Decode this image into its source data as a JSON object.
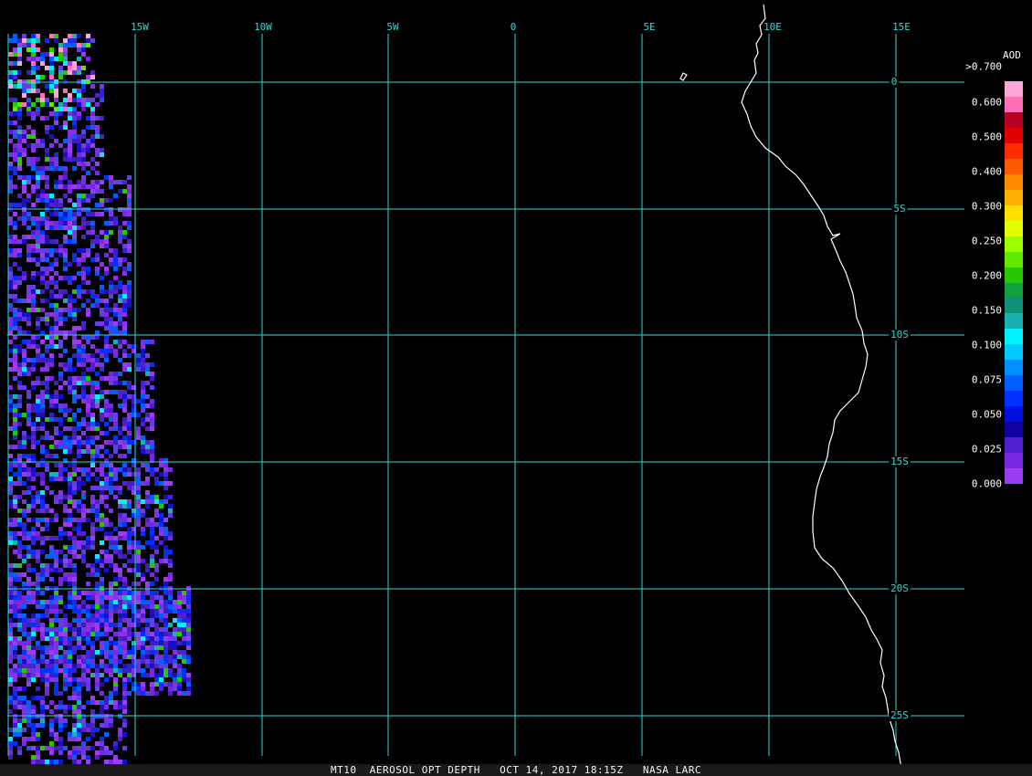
{
  "map": {
    "longitude_labels": [
      "15W",
      "10W",
      "5W",
      "0",
      "5E",
      "10E",
      "15E"
    ],
    "latitude_labels": [
      "0",
      "5S",
      "10S",
      "15S",
      "20S",
      "25S"
    ],
    "grid_color": "#2fd8d8",
    "coastline_color": "#ffffff",
    "background_color": "#000000"
  },
  "legend": {
    "title": "AOD",
    "ticks": [
      ">0.700",
      "0.600",
      "0.500",
      "0.400",
      "0.300",
      "0.250",
      "0.200",
      "0.150",
      "0.100",
      "0.075",
      "0.050",
      "0.025",
      "0.000"
    ],
    "colors_top_to_bottom": [
      "#ffa6d8",
      "#ff6fb8",
      "#b80020",
      "#e00000",
      "#ff2a00",
      "#ff5a00",
      "#ff8a00",
      "#ffb000",
      "#ffe000",
      "#e0ff00",
      "#9cff00",
      "#60e800",
      "#28c800",
      "#10a040",
      "#10907a",
      "#18b0b0",
      "#00f0ff",
      "#00c8ff",
      "#0090ff",
      "#0060ff",
      "#0030ff",
      "#0010e0",
      "#1000a0",
      "#5020d0",
      "#7828e0",
      "#9a3cf0"
    ]
  },
  "footer": {
    "text": "MT10  AEROSOL OPT DEPTH   OCT 14, 2017 18:15Z   NASA LARC"
  }
}
